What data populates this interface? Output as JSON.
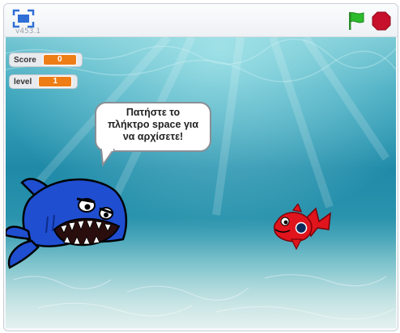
{
  "topbar": {
    "version": "v453.1",
    "fullscreen_icon": "fullscreen-icon",
    "green_flag_icon": "green-flag-icon",
    "stop_icon": "stop-sign-icon",
    "flag_color": "#2dbb2d",
    "stop_color": "#c7102b"
  },
  "monitors": {
    "score": {
      "label": "Score",
      "value": "0"
    },
    "level": {
      "label": "level",
      "value": "1"
    }
  },
  "speech": {
    "line1": "Πατήστε το",
    "line2": "πλήκτρο space για",
    "line3": "να αρχίσετε!"
  },
  "sprites": {
    "shark": "blue-shark-sprite",
    "fish": "red-fish-sprite",
    "shark_color": "#1f4ed1",
    "fish_color": "#e0141c"
  },
  "stage": {
    "backdrop": "underwater"
  }
}
